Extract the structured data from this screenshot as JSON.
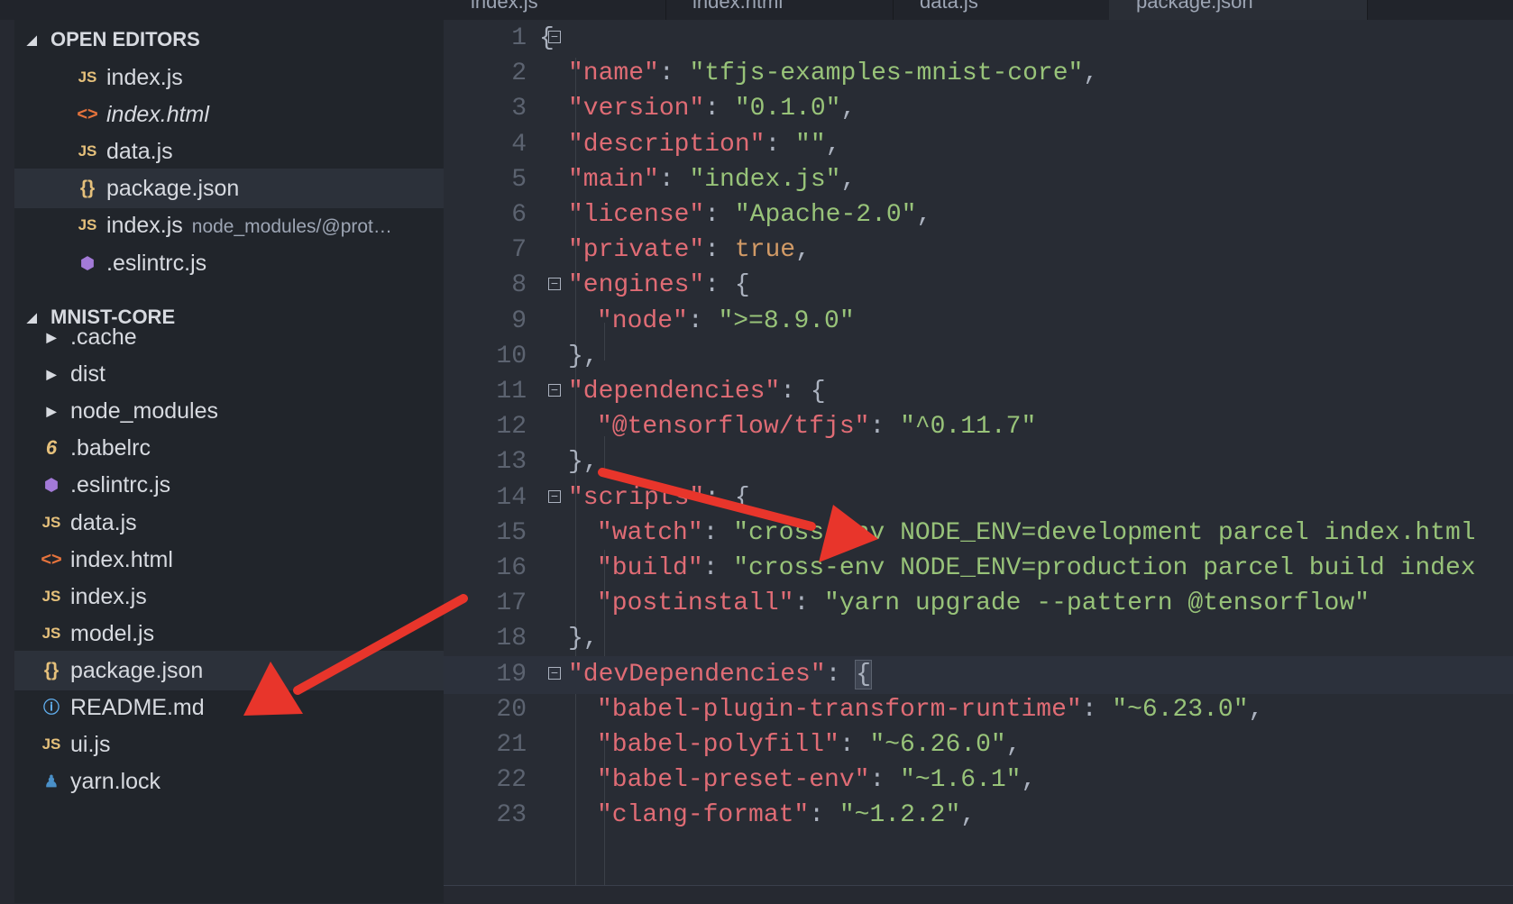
{
  "tabs": [
    {
      "label": "index.js"
    },
    {
      "label": "index.html"
    },
    {
      "label": "data.js"
    },
    {
      "label": "package.json"
    }
  ],
  "sidebar": {
    "open_editors": {
      "title": "OPEN EDITORS",
      "items": [
        {
          "icon": "js-icon",
          "label": "index.js",
          "desc": ""
        },
        {
          "icon": "html-icon",
          "label": "index.html",
          "desc": ""
        },
        {
          "icon": "js-icon",
          "label": "data.js",
          "desc": ""
        },
        {
          "icon": "json-icon",
          "label": "package.json",
          "desc": ""
        },
        {
          "icon": "js-icon",
          "label": "index.js",
          "desc": "node_modules/@prot…"
        },
        {
          "icon": "eslint-icon",
          "label": ".eslintrc.js",
          "desc": ""
        }
      ]
    },
    "project": {
      "title": "MNIST-CORE",
      "items": [
        {
          "icon": "folder-caret-icon",
          "label": ".cache"
        },
        {
          "icon": "folder-caret-icon",
          "label": "dist"
        },
        {
          "icon": "folder-caret-icon",
          "label": "node_modules"
        },
        {
          "icon": "babel-icon",
          "label": ".babelrc"
        },
        {
          "icon": "eslint-icon",
          "label": ".eslintrc.js"
        },
        {
          "icon": "js-icon",
          "label": "data.js"
        },
        {
          "icon": "html-icon",
          "label": "index.html"
        },
        {
          "icon": "js-icon",
          "label": "index.js"
        },
        {
          "icon": "js-icon",
          "label": "model.js"
        },
        {
          "icon": "json-icon",
          "label": "package.json"
        },
        {
          "icon": "info-icon",
          "label": "README.md"
        },
        {
          "icon": "js-icon",
          "label": "ui.js"
        },
        {
          "icon": "yarn-icon",
          "label": "yarn.lock"
        }
      ]
    }
  },
  "icon_glyphs": {
    "js": "JS",
    "html": "<>",
    "json": "{}",
    "eslint": "⬢",
    "babel": "6",
    "info": "ⓘ",
    "yarn": "♟",
    "caret_right": "▶",
    "caret_down": "◢",
    "fold": "−"
  },
  "editor": {
    "lines": [
      {
        "n": "1",
        "indent": 0,
        "fold": true,
        "tokens": [
          [
            "punc",
            "{"
          ]
        ]
      },
      {
        "n": "2",
        "indent": 1,
        "tokens": [
          [
            "key",
            "\"name\""
          ],
          [
            "punc",
            ": "
          ],
          [
            "str",
            "\"tfjs-examples-mnist-core\""
          ],
          [
            "punc",
            ","
          ]
        ]
      },
      {
        "n": "3",
        "indent": 1,
        "tokens": [
          [
            "key",
            "\"version\""
          ],
          [
            "punc",
            ": "
          ],
          [
            "str",
            "\"0.1.0\""
          ],
          [
            "punc",
            ","
          ]
        ]
      },
      {
        "n": "4",
        "indent": 1,
        "tokens": [
          [
            "key",
            "\"description\""
          ],
          [
            "punc",
            ": "
          ],
          [
            "str",
            "\"\""
          ],
          [
            "punc",
            ","
          ]
        ]
      },
      {
        "n": "5",
        "indent": 1,
        "tokens": [
          [
            "key",
            "\"main\""
          ],
          [
            "punc",
            ": "
          ],
          [
            "str",
            "\"index.js\""
          ],
          [
            "punc",
            ","
          ]
        ]
      },
      {
        "n": "6",
        "indent": 1,
        "tokens": [
          [
            "key",
            "\"license\""
          ],
          [
            "punc",
            ": "
          ],
          [
            "str",
            "\"Apache-2.0\""
          ],
          [
            "punc",
            ","
          ]
        ]
      },
      {
        "n": "7",
        "indent": 1,
        "tokens": [
          [
            "key",
            "\"private\""
          ],
          [
            "punc",
            ": "
          ],
          [
            "bool",
            "true"
          ],
          [
            "punc",
            ","
          ]
        ]
      },
      {
        "n": "8",
        "indent": 1,
        "fold": true,
        "tokens": [
          [
            "key",
            "\"engines\""
          ],
          [
            "punc",
            ": {"
          ]
        ]
      },
      {
        "n": "9",
        "indent": 2,
        "tokens": [
          [
            "key",
            "\"node\""
          ],
          [
            "punc",
            ": "
          ],
          [
            "str",
            "\">=8.9.0\""
          ]
        ]
      },
      {
        "n": "10",
        "indent": 1,
        "tokens": [
          [
            "punc",
            "},"
          ]
        ]
      },
      {
        "n": "11",
        "indent": 1,
        "fold": true,
        "tokens": [
          [
            "key",
            "\"dependencies\""
          ],
          [
            "punc",
            ": {"
          ]
        ]
      },
      {
        "n": "12",
        "indent": 2,
        "tokens": [
          [
            "key",
            "\"@tensorflow/tfjs\""
          ],
          [
            "punc",
            ": "
          ],
          [
            "str",
            "\"^0.11.7\""
          ]
        ]
      },
      {
        "n": "13",
        "indent": 1,
        "tokens": [
          [
            "punc",
            "},"
          ]
        ]
      },
      {
        "n": "14",
        "indent": 1,
        "fold": true,
        "tokens": [
          [
            "key",
            "\"scripts\""
          ],
          [
            "punc",
            ": {"
          ]
        ]
      },
      {
        "n": "15",
        "indent": 2,
        "tokens": [
          [
            "key",
            "\"watch\""
          ],
          [
            "punc",
            ": "
          ],
          [
            "str",
            "\"cross-env NODE_ENV=development parcel index.html"
          ]
        ]
      },
      {
        "n": "16",
        "indent": 2,
        "tokens": [
          [
            "key",
            "\"build\""
          ],
          [
            "punc",
            ": "
          ],
          [
            "str",
            "\"cross-env NODE_ENV=production parcel build index"
          ]
        ]
      },
      {
        "n": "17",
        "indent": 2,
        "tokens": [
          [
            "key",
            "\"postinstall\""
          ],
          [
            "punc",
            ": "
          ],
          [
            "str",
            "\"yarn upgrade --pattern @tensorflow\""
          ]
        ]
      },
      {
        "n": "18",
        "indent": 1,
        "tokens": [
          [
            "punc",
            "},"
          ]
        ]
      },
      {
        "n": "19",
        "indent": 1,
        "fold": true,
        "current": true,
        "tokens": [
          [
            "key",
            "\"devDependencies\""
          ],
          [
            "punc",
            ": "
          ],
          [
            "hl",
            "{"
          ]
        ]
      },
      {
        "n": "20",
        "indent": 2,
        "tokens": [
          [
            "key",
            "\"babel-plugin-transform-runtime\""
          ],
          [
            "punc",
            ": "
          ],
          [
            "str",
            "\"~6.23.0\""
          ],
          [
            "punc",
            ","
          ]
        ]
      },
      {
        "n": "21",
        "indent": 2,
        "tokens": [
          [
            "key",
            "\"babel-polyfill\""
          ],
          [
            "punc",
            ": "
          ],
          [
            "str",
            "\"~6.26.0\""
          ],
          [
            "punc",
            ","
          ]
        ]
      },
      {
        "n": "22",
        "indent": 2,
        "tokens": [
          [
            "key",
            "\"babel-preset-env\""
          ],
          [
            "punc",
            ": "
          ],
          [
            "str",
            "\"~1.6.1\""
          ],
          [
            "punc",
            ","
          ]
        ]
      },
      {
        "n": "23",
        "indent": 2,
        "tokens": [
          [
            "key",
            "\"clang-format\""
          ],
          [
            "punc",
            ": "
          ],
          [
            "str",
            "\"~1.2.2\""
          ],
          [
            "punc",
            ","
          ]
        ]
      }
    ]
  },
  "colors": {
    "annotation_arrow": "#e8352b"
  }
}
